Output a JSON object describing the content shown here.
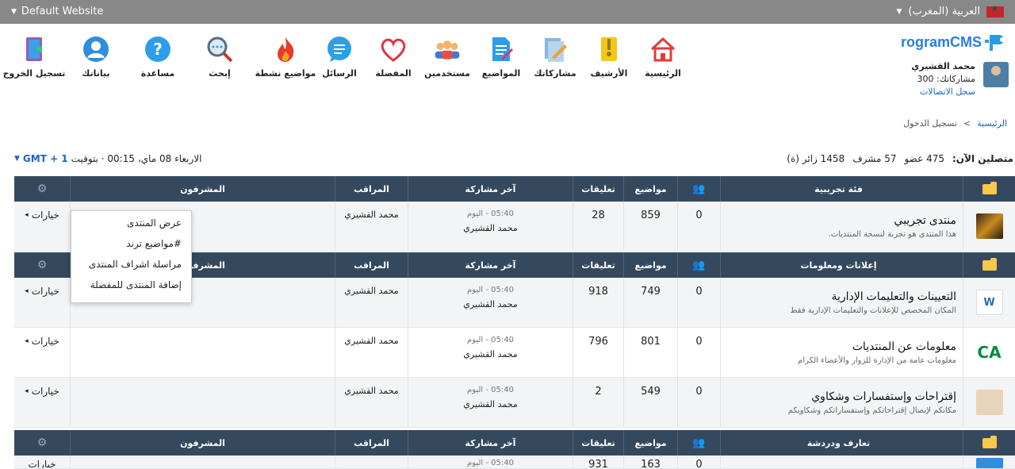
{
  "topbar": {
    "site_name": "Default Website",
    "language": "العربية (المغرب)"
  },
  "logo": {
    "text": "rogramCMS"
  },
  "user": {
    "name": "محمد القشيري",
    "posts_label": "مشاركاتك: 300",
    "log_link": "سجل الاتصالات"
  },
  "nav": {
    "items": [
      {
        "label": "الرئيسية",
        "icon": "home-icon"
      },
      {
        "label": "الأرشيف",
        "icon": "archive-icon"
      },
      {
        "label": "مشاركاتك",
        "icon": "my-posts-icon"
      },
      {
        "label": "المواضيع",
        "icon": "topics-icon"
      },
      {
        "label": "مستخدمين",
        "icon": "users-icon"
      },
      {
        "label": "المفضلة",
        "icon": "heart-icon"
      },
      {
        "label": "الرسائل",
        "icon": "messages-icon"
      },
      {
        "label": "مواضيع نشطة",
        "icon": "fire-icon"
      }
    ],
    "left_items": [
      {
        "label": "إبحث",
        "icon": "search-icon"
      },
      {
        "label": "مساعدة",
        "icon": "help-icon"
      },
      {
        "label": "بياناتك",
        "icon": "profile-icon"
      },
      {
        "label": "تسجيل الخروج",
        "icon": "logout-icon"
      }
    ]
  },
  "breadcrumb": {
    "home": "الرئيسية",
    "sep": ">",
    "current": "تسجيل الدخول"
  },
  "stats": {
    "label": "متصلين الآن:",
    "members": "475 عضو",
    "mods": "57 مشرف",
    "visitors": "1458 زائر (ة)"
  },
  "time": {
    "text": "الاربعاء 08 ماي، 00:15 · بتوقيت",
    "gmt": "GMT + 1"
  },
  "columns": {
    "topics": "مواضيع",
    "comments": "تعليقات",
    "last_post": "آخر مشاركة",
    "moderator": "المراقب",
    "supervisors": "المشرفون"
  },
  "categories": [
    {
      "title": "فئة تجريبية",
      "forums": [
        {
          "name": "منتدى تجريبي",
          "desc": "هذا المنتدى هو تجربة لنسخة المنتديات.",
          "online": "0",
          "topics": "859",
          "comments": "28",
          "last_time": "05:40 - اليوم",
          "last_user": "محمد القشيري",
          "moderator": "محمد القشيري",
          "options": "خيارات"
        }
      ]
    },
    {
      "title": "إعلانات ومعلومات",
      "forums": [
        {
          "name": "التعيينات والتعليمات الإدارية",
          "desc": "المكان المخصص للإعلانات والتعليمات الإدارية فقط",
          "online": "0",
          "topics": "749",
          "comments": "918",
          "last_time": "05:40 - اليوم",
          "last_user": "محمد القشيري",
          "moderator": "محمد القشيري",
          "options": "خيارات"
        },
        {
          "name": "معلومات عن المنتديات",
          "desc": "معلومات عامة من الإدارة للزوار والأعضاء الكرام",
          "online": "0",
          "topics": "801",
          "comments": "796",
          "last_time": "05:40 - اليوم",
          "last_user": "محمد القشيري",
          "moderator": "محمد القشيري",
          "options": "خيارات"
        },
        {
          "name": "إقتراحات وإستفسارات وشكاوي",
          "desc": "مكانكم لإيصال إقتراحاتكم وإستفساراتكم وشكاويكم",
          "online": "0",
          "topics": "549",
          "comments": "2",
          "last_time": "05:40 - اليوم",
          "last_user": "محمد القشيري",
          "moderator": "محمد القشيري",
          "options": "خيارات"
        }
      ]
    },
    {
      "title": "تعارف ودردشة",
      "forums": [
        {
          "name": "",
          "desc": "",
          "online": "0",
          "topics": "163",
          "comments": "931",
          "last_time": "05:40 - اليوم",
          "last_user": "",
          "moderator": "",
          "options": "خيارات"
        }
      ]
    }
  ],
  "dropdown": {
    "items": [
      "عرض المنتدى",
      "#مواضيع ترند",
      "مراسلة اشراف المنتدى",
      "إضافة المنتدى للمفضلة"
    ]
  }
}
